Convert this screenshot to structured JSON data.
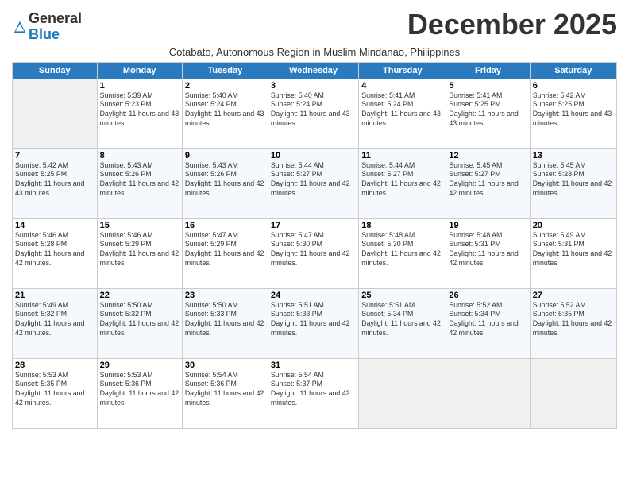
{
  "logo": {
    "general": "General",
    "blue": "Blue"
  },
  "title": "December 2025",
  "subtitle": "Cotabato, Autonomous Region in Muslim Mindanao, Philippines",
  "days_header": [
    "Sunday",
    "Monday",
    "Tuesday",
    "Wednesday",
    "Thursday",
    "Friday",
    "Saturday"
  ],
  "weeks": [
    [
      {
        "day": "",
        "empty": true
      },
      {
        "day": "1",
        "sunrise": "Sunrise: 5:39 AM",
        "sunset": "Sunset: 5:23 PM",
        "daylight": "Daylight: 11 hours and 43 minutes."
      },
      {
        "day": "2",
        "sunrise": "Sunrise: 5:40 AM",
        "sunset": "Sunset: 5:24 PM",
        "daylight": "Daylight: 11 hours and 43 minutes."
      },
      {
        "day": "3",
        "sunrise": "Sunrise: 5:40 AM",
        "sunset": "Sunset: 5:24 PM",
        "daylight": "Daylight: 11 hours and 43 minutes."
      },
      {
        "day": "4",
        "sunrise": "Sunrise: 5:41 AM",
        "sunset": "Sunset: 5:24 PM",
        "daylight": "Daylight: 11 hours and 43 minutes."
      },
      {
        "day": "5",
        "sunrise": "Sunrise: 5:41 AM",
        "sunset": "Sunset: 5:25 PM",
        "daylight": "Daylight: 11 hours and 43 minutes."
      },
      {
        "day": "6",
        "sunrise": "Sunrise: 5:42 AM",
        "sunset": "Sunset: 5:25 PM",
        "daylight": "Daylight: 11 hours and 43 minutes."
      }
    ],
    [
      {
        "day": "7",
        "sunrise": "Sunrise: 5:42 AM",
        "sunset": "Sunset: 5:25 PM",
        "daylight": "Daylight: 11 hours and 43 minutes."
      },
      {
        "day": "8",
        "sunrise": "Sunrise: 5:43 AM",
        "sunset": "Sunset: 5:26 PM",
        "daylight": "Daylight: 11 hours and 42 minutes."
      },
      {
        "day": "9",
        "sunrise": "Sunrise: 5:43 AM",
        "sunset": "Sunset: 5:26 PM",
        "daylight": "Daylight: 11 hours and 42 minutes."
      },
      {
        "day": "10",
        "sunrise": "Sunrise: 5:44 AM",
        "sunset": "Sunset: 5:27 PM",
        "daylight": "Daylight: 11 hours and 42 minutes."
      },
      {
        "day": "11",
        "sunrise": "Sunrise: 5:44 AM",
        "sunset": "Sunset: 5:27 PM",
        "daylight": "Daylight: 11 hours and 42 minutes."
      },
      {
        "day": "12",
        "sunrise": "Sunrise: 5:45 AM",
        "sunset": "Sunset: 5:27 PM",
        "daylight": "Daylight: 11 hours and 42 minutes."
      },
      {
        "day": "13",
        "sunrise": "Sunrise: 5:45 AM",
        "sunset": "Sunset: 5:28 PM",
        "daylight": "Daylight: 11 hours and 42 minutes."
      }
    ],
    [
      {
        "day": "14",
        "sunrise": "Sunrise: 5:46 AM",
        "sunset": "Sunset: 5:28 PM",
        "daylight": "Daylight: 11 hours and 42 minutes."
      },
      {
        "day": "15",
        "sunrise": "Sunrise: 5:46 AM",
        "sunset": "Sunset: 5:29 PM",
        "daylight": "Daylight: 11 hours and 42 minutes."
      },
      {
        "day": "16",
        "sunrise": "Sunrise: 5:47 AM",
        "sunset": "Sunset: 5:29 PM",
        "daylight": "Daylight: 11 hours and 42 minutes."
      },
      {
        "day": "17",
        "sunrise": "Sunrise: 5:47 AM",
        "sunset": "Sunset: 5:30 PM",
        "daylight": "Daylight: 11 hours and 42 minutes."
      },
      {
        "day": "18",
        "sunrise": "Sunrise: 5:48 AM",
        "sunset": "Sunset: 5:30 PM",
        "daylight": "Daylight: 11 hours and 42 minutes."
      },
      {
        "day": "19",
        "sunrise": "Sunrise: 5:48 AM",
        "sunset": "Sunset: 5:31 PM",
        "daylight": "Daylight: 11 hours and 42 minutes."
      },
      {
        "day": "20",
        "sunrise": "Sunrise: 5:49 AM",
        "sunset": "Sunset: 5:31 PM",
        "daylight": "Daylight: 11 hours and 42 minutes."
      }
    ],
    [
      {
        "day": "21",
        "sunrise": "Sunrise: 5:49 AM",
        "sunset": "Sunset: 5:32 PM",
        "daylight": "Daylight: 11 hours and 42 minutes."
      },
      {
        "day": "22",
        "sunrise": "Sunrise: 5:50 AM",
        "sunset": "Sunset: 5:32 PM",
        "daylight": "Daylight: 11 hours and 42 minutes."
      },
      {
        "day": "23",
        "sunrise": "Sunrise: 5:50 AM",
        "sunset": "Sunset: 5:33 PM",
        "daylight": "Daylight: 11 hours and 42 minutes."
      },
      {
        "day": "24",
        "sunrise": "Sunrise: 5:51 AM",
        "sunset": "Sunset: 5:33 PM",
        "daylight": "Daylight: 11 hours and 42 minutes."
      },
      {
        "day": "25",
        "sunrise": "Sunrise: 5:51 AM",
        "sunset": "Sunset: 5:34 PM",
        "daylight": "Daylight: 11 hours and 42 minutes."
      },
      {
        "day": "26",
        "sunrise": "Sunrise: 5:52 AM",
        "sunset": "Sunset: 5:34 PM",
        "daylight": "Daylight: 11 hours and 42 minutes."
      },
      {
        "day": "27",
        "sunrise": "Sunrise: 5:52 AM",
        "sunset": "Sunset: 5:35 PM",
        "daylight": "Daylight: 11 hours and 42 minutes."
      }
    ],
    [
      {
        "day": "28",
        "sunrise": "Sunrise: 5:53 AM",
        "sunset": "Sunset: 5:35 PM",
        "daylight": "Daylight: 11 hours and 42 minutes."
      },
      {
        "day": "29",
        "sunrise": "Sunrise: 5:53 AM",
        "sunset": "Sunset: 5:36 PM",
        "daylight": "Daylight: 11 hours and 42 minutes."
      },
      {
        "day": "30",
        "sunrise": "Sunrise: 5:54 AM",
        "sunset": "Sunset: 5:36 PM",
        "daylight": "Daylight: 11 hours and 42 minutes."
      },
      {
        "day": "31",
        "sunrise": "Sunrise: 5:54 AM",
        "sunset": "Sunset: 5:37 PM",
        "daylight": "Daylight: 11 hours and 42 minutes."
      },
      {
        "day": "",
        "empty": true
      },
      {
        "day": "",
        "empty": true
      },
      {
        "day": "",
        "empty": true
      }
    ]
  ]
}
